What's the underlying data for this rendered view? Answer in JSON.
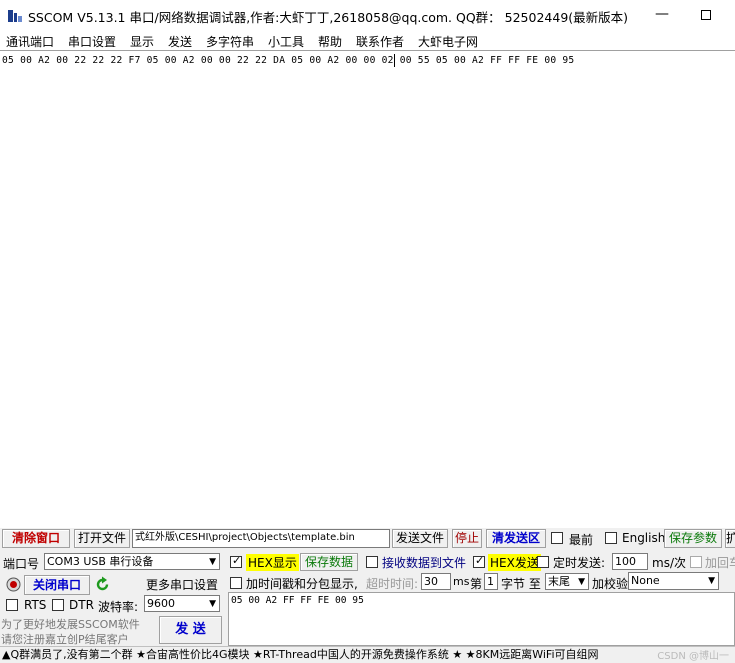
{
  "window": {
    "title": "SSCOM V5.13.1 串口/网络数据调试器,作者:大虾丁丁,2618058@qq.com. QQ群： 52502449(最新版本)",
    "minimize_glyph": "—"
  },
  "menu": {
    "items": [
      "通讯端口",
      "串口设置",
      "显示",
      "发送",
      "多字符串",
      "小工具",
      "帮助",
      "联系作者",
      "大虾电子网"
    ]
  },
  "receive": {
    "text": "05 00 A2 00 22 22 22 F7 05 00 A2 00 00 22 22 DA 05 00 A2 00 00 02 00 55 05 00 A2 FF FF FE 00 95"
  },
  "toolbar": {
    "clear_window": "清除窗口",
    "open_file": "打开文件",
    "file_path": "式红外版\\CESHI\\project\\Objects\\template.bin",
    "send_file": "发送文件",
    "stop": "停止",
    "clear_send": "清发送区",
    "topmost": "最前",
    "english": "English",
    "save_params": "保存参数",
    "expand": "扩"
  },
  "port": {
    "label": "端口号",
    "value": "COM3 USB 串行设备",
    "close_port": "关闭串口",
    "more_settings": "更多串口设置",
    "rts": "RTS",
    "dtr": "DTR",
    "baud_label": "波特率:",
    "baud_value": "9600"
  },
  "options": {
    "hex_display": "HEX显示",
    "save_data": "保存数据",
    "recv_to_file": "接收数据到文件",
    "hex_send": "HEX发送",
    "timed_send": "定时发送:",
    "interval": "100",
    "interval_unit": "ms/次",
    "add_crlf": "加回车",
    "timestamp": "加时间戳和分包显示,",
    "timeout_label": "超时时间:",
    "timeout_value": "30",
    "timeout_unit": "ms",
    "byte_prefix": "第",
    "byte_value": "1",
    "byte_suffix": "字节 至",
    "end_value": "末尾",
    "checksum_label": "加校验",
    "checksum_value": "None"
  },
  "send": {
    "text": "05 00 A2 FF FF FE 00 95",
    "button": "发 送"
  },
  "promo": {
    "line1": "为了更好地发展SSCOM软件",
    "line2": "请您注册嘉立创P结尾客户"
  },
  "status": {
    "text": "▲Q群满员了,没有第二个群  ★合宙高性价比4G模块  ★RT-Thread中国人的开源免费操作系统  ★  ★8KM远距离WiFi可自组网",
    "watermark": "CSDN @博山一"
  },
  "colors": {
    "red_text": "#c00000",
    "hex_highlight": "#ffff00",
    "green_text": "#0a7a0a",
    "blue_text": "#0000cc"
  }
}
